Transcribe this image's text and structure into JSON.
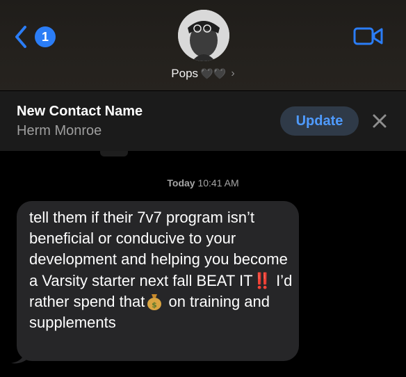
{
  "header": {
    "back_badge": "1",
    "contact_name": "Pops",
    "contact_hearts": "🖤🖤",
    "contact_chevron": "›"
  },
  "banner": {
    "title": "New Contact Name",
    "subtitle": "Herm Monroe",
    "update_label": "Update"
  },
  "messages": {
    "day": "Today",
    "time": "10:41 AM",
    "received": {
      "part1": "tell them if their 7v7 program isn’t beneficial or conducive to your development and helping you become a Varsity starter next fall BEAT IT",
      "emoji1": "‼️",
      "part2": " I’d rather spend that",
      "emoji2": "💰",
      "part3": "on training and supplements"
    }
  },
  "colors": {
    "accent": "#2b7df6",
    "bubble": "#262628",
    "banner": "#1b1b1b",
    "update_bg": "#2f3a48",
    "update_text": "#4f9bff"
  },
  "icons": {
    "back": "chevron-left-icon",
    "video": "video-camera-icon",
    "close": "close-icon",
    "money": "money-bag-icon",
    "exclaim": "double-exclamation-icon"
  }
}
